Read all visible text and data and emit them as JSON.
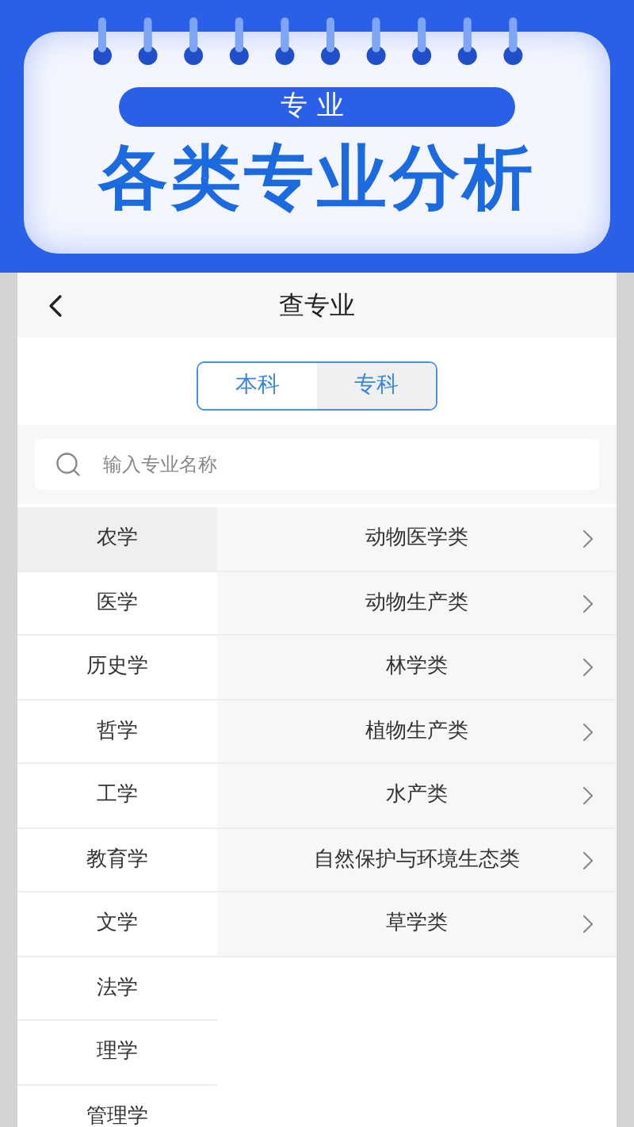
{
  "banner": {
    "tag": "专业",
    "title": "各类专业分析"
  },
  "nav": {
    "title": "查专业"
  },
  "tabs": [
    {
      "label": "本科",
      "selected": true
    },
    {
      "label": "专科",
      "selected": false
    }
  ],
  "search": {
    "placeholder": "输入专业名称"
  },
  "categories": [
    {
      "label": "农学",
      "selected": true
    },
    {
      "label": "医学",
      "selected": false
    },
    {
      "label": "历史学",
      "selected": false
    },
    {
      "label": "哲学",
      "selected": false
    },
    {
      "label": "工学",
      "selected": false
    },
    {
      "label": "教育学",
      "selected": false
    },
    {
      "label": "文学",
      "selected": false
    },
    {
      "label": "法学",
      "selected": false
    },
    {
      "label": "理学",
      "selected": false
    },
    {
      "label": "管理学",
      "selected": false
    }
  ],
  "majors": [
    "动物医学类",
    "动物生产类",
    "林学类",
    "植物生产类",
    "水产类",
    "自然保护与环境生态类",
    "草学类"
  ]
}
